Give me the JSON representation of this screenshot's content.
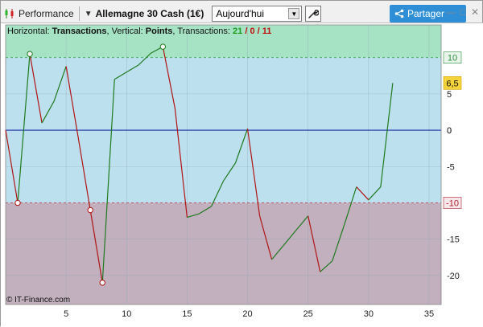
{
  "toolbar": {
    "performance_label": "Performance",
    "market_label": "Allemagne 30 Cash (1€)",
    "period_value": "Aujourd'hui",
    "share_label": "Partager"
  },
  "legend": {
    "prefix": "Horizontal: ",
    "x_name": "Transactions",
    "mid": ", Vertical: ",
    "y_name": "Points",
    "count_label": ", Transactions: ",
    "wins": "21",
    "sep1": " / ",
    "neutral": "0",
    "sep2": " / ",
    "losses": "11"
  },
  "copyright": "© IT-Finance.com",
  "colors": {
    "upper_zone": "#a6e3c4",
    "middle_zone": "#bde0ee",
    "lower_zone": "#c2b0be",
    "up_segment": "#1d7a1d",
    "down_segment": "#b01414",
    "zero_line": "#1a2aa8",
    "last_value_badge": "#f5d33a"
  },
  "chart_data": {
    "type": "line",
    "xlabel": "",
    "ylabel": "",
    "x_range": [
      0,
      36
    ],
    "y_range": [
      -24,
      14.5
    ],
    "x_ticks": [
      5,
      10,
      15,
      20,
      25,
      30,
      35
    ],
    "y_ticks": [
      5,
      0,
      -5,
      -15,
      -20
    ],
    "zones": {
      "upper_threshold": 10,
      "lower_threshold": -10
    },
    "threshold_labels": [
      "10",
      "-10"
    ],
    "zero_label": "0",
    "last_value_label": "6,5",
    "series": [
      {
        "x": [
          0,
          1,
          2,
          3,
          4,
          5,
          6,
          7,
          8,
          9,
          10,
          11,
          12,
          13,
          14,
          15,
          16,
          17,
          18,
          19,
          20,
          21,
          22,
          23,
          24,
          25,
          26,
          27,
          28,
          29,
          30,
          31,
          32
        ],
        "y": [
          0,
          -10,
          10.5,
          1,
          4,
          8.8,
          -1,
          -11,
          -21,
          7,
          8,
          9,
          10.6,
          11.5,
          3,
          -12,
          -11.5,
          -10.5,
          -7,
          -4.5,
          0.2,
          -11.8,
          -17.8,
          -15.8,
          -13.8,
          -11.8,
          -19.5,
          -18,
          -13,
          -7.8,
          -9.6,
          -7.8,
          6.5
        ],
        "markers": [
          {
            "x": 1,
            "y": -10,
            "kind": "low"
          },
          {
            "x": 2,
            "y": 10.5,
            "kind": "high"
          },
          {
            "x": 7,
            "y": -11,
            "kind": "low"
          },
          {
            "x": 8,
            "y": -21,
            "kind": "low"
          },
          {
            "x": 13,
            "y": 11.5,
            "kind": "high"
          }
        ]
      }
    ]
  }
}
